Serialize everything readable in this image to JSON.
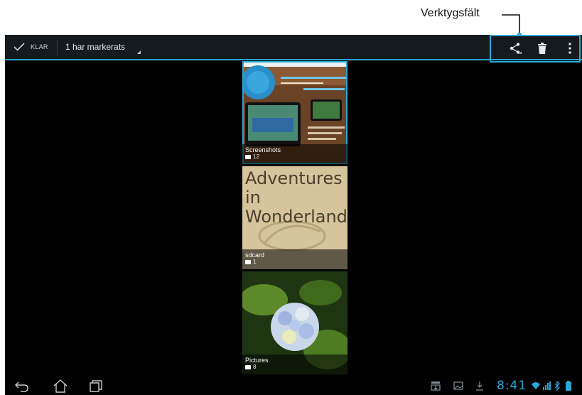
{
  "annotation": {
    "toolbar_label": "Verktygsfält"
  },
  "action_bar": {
    "done_label": "KLAR",
    "selection_text": "1 har markerats",
    "actions": [
      {
        "icon": "share-icon"
      },
      {
        "icon": "trash-icon"
      },
      {
        "icon": "overflow-menu-icon"
      }
    ]
  },
  "albums": [
    {
      "name": "Screenshots",
      "count": "12",
      "selected": true
    },
    {
      "name": "sdcard",
      "count": "1",
      "cover_text": "Adventures in Wonderland"
    },
    {
      "name": "Pictures",
      "count": "8"
    }
  ],
  "system_bar": {
    "time": "8:41",
    "nav": [
      "back-icon",
      "home-icon",
      "recent-apps-icon"
    ],
    "status_icons": [
      "usb-icon",
      "gallery-icon",
      "download-icon",
      "wifi-icon",
      "signal-icon",
      "bluetooth-icon",
      "battery-icon"
    ]
  },
  "colors": {
    "accent": "#2aa8d6",
    "action_bar_bg": "#151a1e",
    "screen_bg": "#000000"
  }
}
